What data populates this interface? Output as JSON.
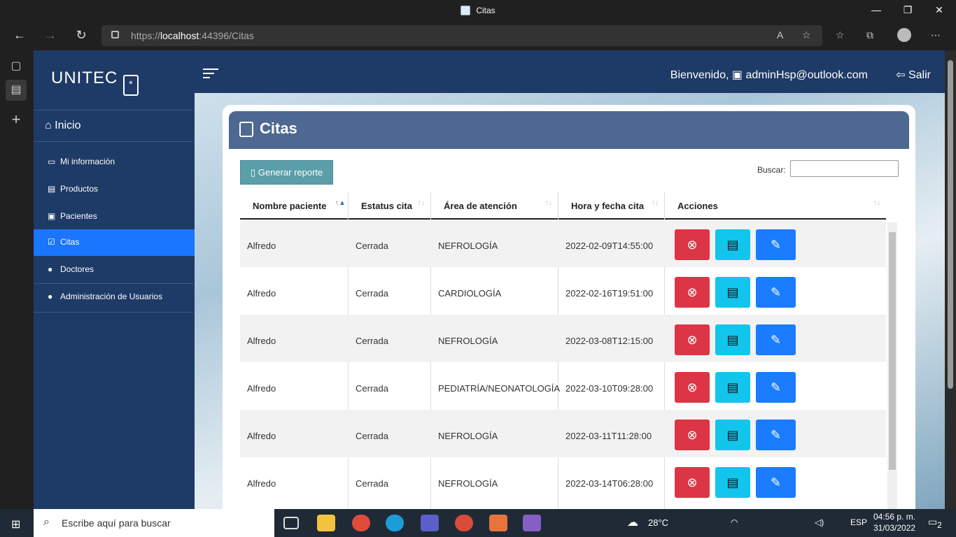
{
  "browser": {
    "window_title": "Citas",
    "url_prefix": "https://",
    "url_host": "localhost",
    "url_rest": ":44396/Citas"
  },
  "sidebar": {
    "brand": "UNITEC",
    "home": "Inicio",
    "items": [
      {
        "label": "Mi información",
        "icon": "id-card-icon"
      },
      {
        "label": "Productos",
        "icon": "inbox-icon"
      },
      {
        "label": "Pacientes",
        "icon": "patient-icon"
      },
      {
        "label": "Citas",
        "icon": "calendar-check-icon"
      },
      {
        "label": "Doctores",
        "icon": "users-icon"
      },
      {
        "label": "Administración de Usuarios",
        "icon": "users-cog-icon"
      }
    ],
    "active_item": "Citas"
  },
  "topbar": {
    "welcome": "Bienvenido,",
    "user": "adminHsp@outlook.com",
    "logout": "Salir"
  },
  "page": {
    "title": "Citas",
    "report_button": "Generar reporte",
    "search_label": "Buscar:",
    "search_value": ""
  },
  "table": {
    "columns": [
      "Nombre paciente",
      "Estatus cita",
      "Área de atención",
      "Hora y fecha cita",
      "Acciones"
    ],
    "rows": [
      [
        "Alfredo",
        "Cerrada",
        "NEFROLOGÍA",
        "2022-02-09T14:55:00"
      ],
      [
        "Alfredo",
        "Cerrada",
        "CARDIOLOGÍA",
        "2022-02-16T19:51:00"
      ],
      [
        "Alfredo",
        "Cerrada",
        "NEFROLOGÍA",
        "2022-03-08T12:15:00"
      ],
      [
        "Alfredo",
        "Cerrada",
        "PEDIATRÍA/NEONATOLOGÍA",
        "2022-03-10T09:28:00"
      ],
      [
        "Alfredo",
        "Cerrada",
        "NEFROLOGÍA",
        "2022-03-11T11:28:00"
      ],
      [
        "Alfredo",
        "Cerrada",
        "NEFROLOGÍA",
        "2022-03-14T06:28:00"
      ]
    ]
  },
  "taskbar": {
    "search_placeholder": "Escribe aquí para buscar",
    "temperature": "28°C",
    "lang": "ESP",
    "time": "04:56 p. m.",
    "date": "31/03/2022",
    "notifications": "2"
  },
  "colors": {
    "sidebar": "#1e3a66",
    "active": "#1a75ff",
    "danger": "#dc3545",
    "info": "#11c5ec",
    "primary": "#1a7cff"
  }
}
